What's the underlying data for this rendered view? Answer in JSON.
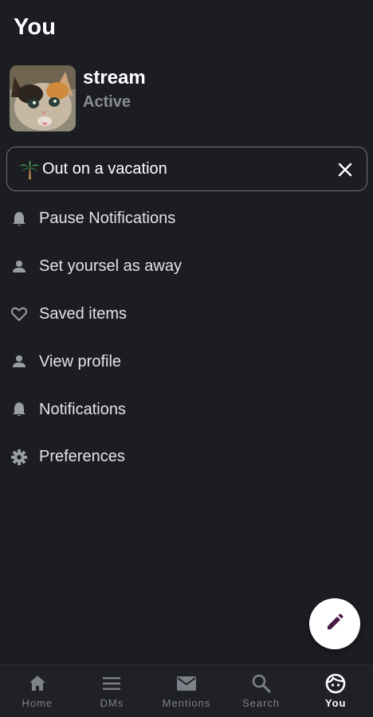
{
  "header": {
    "title": "You"
  },
  "profile": {
    "username": "stream",
    "presence": "Active"
  },
  "status": {
    "emoji": "palm-tree-icon",
    "text": "Out on a vacation"
  },
  "menu": {
    "items": [
      {
        "label": "Pause Notifications",
        "icon": "bell-icon"
      },
      {
        "label": "Set yoursel as away",
        "icon": "person-icon"
      },
      {
        "label": "Saved items",
        "icon": "heart-icon"
      },
      {
        "label": "View profile",
        "icon": "person-icon"
      },
      {
        "label": "Notifications",
        "icon": "bell-icon"
      },
      {
        "label": "Preferences",
        "icon": "gear-icon"
      }
    ]
  },
  "fab": {
    "icon": "pencil-icon"
  },
  "tabs": [
    {
      "label": "Home",
      "icon": "home-icon",
      "active": false
    },
    {
      "label": "DMs",
      "icon": "menu-lines-icon",
      "active": false
    },
    {
      "label": "Mentions",
      "icon": "envelope-icon",
      "active": false
    },
    {
      "label": "Search",
      "icon": "search-icon",
      "active": false
    },
    {
      "label": "You",
      "icon": "face-icon",
      "active": true
    }
  ],
  "colors": {
    "background": "#1b1d23",
    "accent_fab_icon": "#4a1a44",
    "muted_text": "#8a8d93",
    "icon_gray": "#9a9da3"
  }
}
